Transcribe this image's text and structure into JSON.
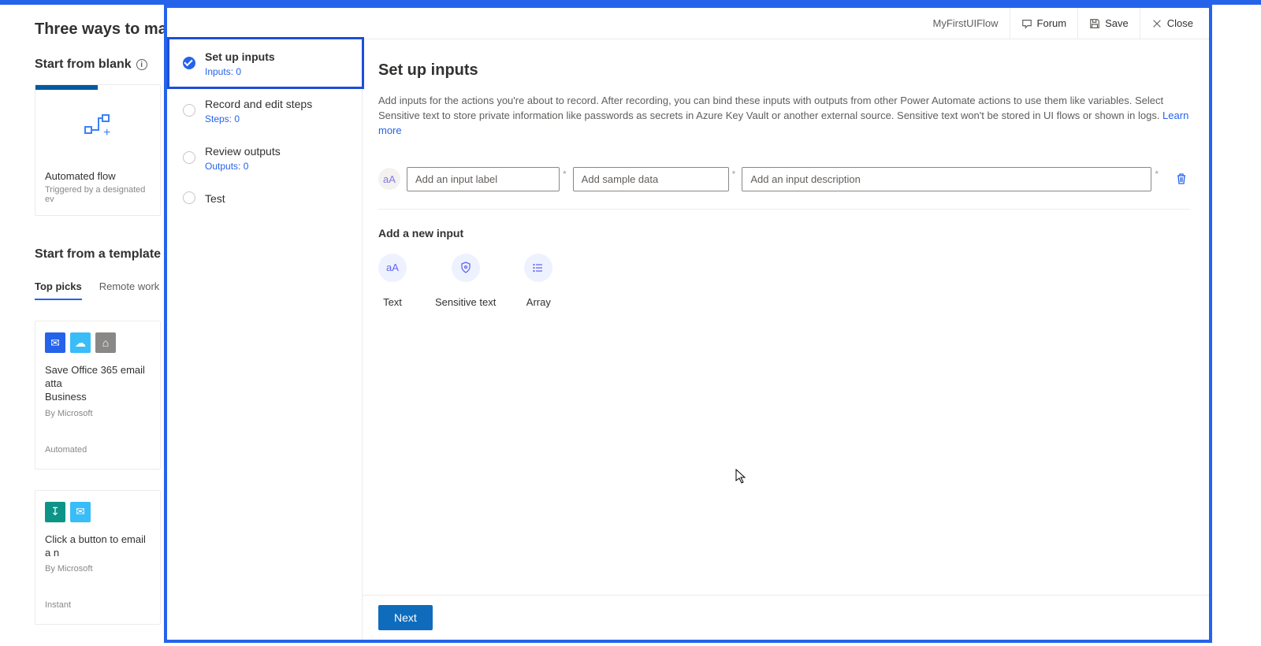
{
  "background": {
    "heading": "Three ways to make a f",
    "start_blank": "Start from blank",
    "auto_flow_card": {
      "title": "Automated flow",
      "subtitle": "Triggered by a designated ev"
    },
    "start_template": "Start from a template",
    "tabs": {
      "top_picks": "Top picks",
      "remote_work": "Remote work"
    },
    "template1": {
      "title": "Save Office 365 email atta",
      "title2": "Business",
      "author": "By Microsoft",
      "type": "Automated"
    },
    "template2": {
      "title": "Click a button to email a n",
      "author": "By Microsoft",
      "type": "Instant"
    }
  },
  "header": {
    "flow_name": "MyFirstUIFlow",
    "forum": "Forum",
    "save": "Save",
    "close": "Close"
  },
  "steps": {
    "s1_title": "Set up inputs",
    "s1_sub": "Inputs: 0",
    "s2_title": "Record and edit steps",
    "s2_sub": "Steps: 0",
    "s3_title": "Review outputs",
    "s3_sub": "Outputs: 0",
    "s4_title": "Test"
  },
  "main": {
    "title": "Set up inputs",
    "description": "Add inputs for the actions you're about to record. After recording, you can bind these inputs with outputs from other Power Automate actions to use them like variables. Select Sensitive text to store private information like passwords as secrets in Azure Key Vault or another external source. Sensitive text won't be stored in UI flows or shown in logs. ",
    "learn_more": "Learn more",
    "placeholders": {
      "label": "Add an input label",
      "sample": "Add sample data",
      "desc": "Add an input description"
    },
    "add_heading": "Add a new input",
    "types": {
      "text": "Text",
      "sensitive": "Sensitive text",
      "array": "Array"
    },
    "next": "Next"
  }
}
